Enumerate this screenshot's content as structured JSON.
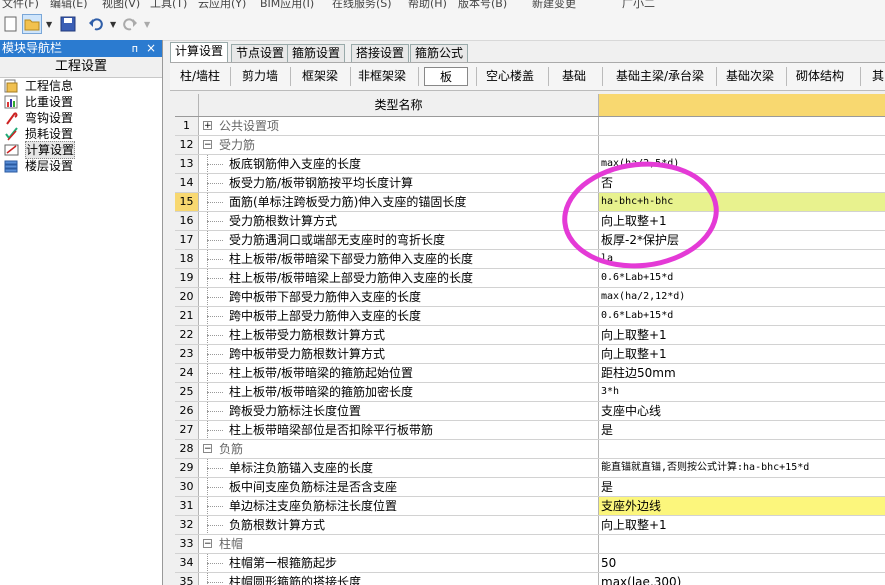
{
  "menu": [
    "文件(F)",
    "编辑(E)",
    "视图(V)",
    "工具(T)",
    "云应用(Y)",
    "BIM应用(I)",
    "在线服务(S)",
    "帮助(H)",
    "版本号(B)",
    "新建变更",
    "广小二"
  ],
  "nav": {
    "title": "模块导航栏",
    "pin_glyph": "ᴨ",
    "close_glyph": "×",
    "section": "工程设置",
    "items": [
      {
        "label": "工程信息",
        "icon": "document-icon"
      },
      {
        "label": "比重设置",
        "icon": "chart-icon"
      },
      {
        "label": "弯钩设置",
        "icon": "hook-icon"
      },
      {
        "label": "损耗设置",
        "icon": "check-icon"
      },
      {
        "label": "计算设置",
        "icon": "calc-icon"
      },
      {
        "label": "楼层设置",
        "icon": "layers-icon"
      }
    ]
  },
  "tabs": [
    "计算设置",
    "节点设置",
    "箍筋设置",
    "搭接设置",
    "箍筋公式"
  ],
  "subtabs": [
    "柱/墙柱",
    "剪力墙",
    "框架梁",
    "非框架梁",
    "板",
    "空心楼盖",
    "基础",
    "基础主梁/承台梁",
    "基础次梁",
    "砌体结构",
    "其"
  ],
  "grid": {
    "header": "类型名称",
    "rows": [
      {
        "n": "1",
        "t": "group",
        "exp": "+",
        "name": "公共设置项",
        "val": ""
      },
      {
        "n": "12",
        "t": "group",
        "exp": "−",
        "name": "受力筋",
        "val": ""
      },
      {
        "n": "13",
        "t": "item",
        "name": "板底钢筋伸入支座的长度",
        "val": "max(ha/2,5*d)"
      },
      {
        "n": "14",
        "t": "item",
        "name": "板受力筋/板带钢筋按平均长度计算",
        "val": "否"
      },
      {
        "n": "15",
        "t": "item",
        "name": "面筋(单标注跨板受力筋)伸入支座的锚固长度",
        "val": "ha-bhc+h-bhc"
      },
      {
        "n": "16",
        "t": "item",
        "name": "受力筋根数计算方式",
        "val": "向上取整+1"
      },
      {
        "n": "17",
        "t": "item",
        "name": "受力筋遇洞口或端部无支座时的弯折长度",
        "val": "板厚-2*保护层"
      },
      {
        "n": "18",
        "t": "item",
        "name": "柱上板带/板带暗梁下部受力筋伸入支座的长度",
        "val": "la"
      },
      {
        "n": "19",
        "t": "item",
        "name": "柱上板带/板带暗梁上部受力筋伸入支座的长度",
        "val": "0.6*Lab+15*d"
      },
      {
        "n": "20",
        "t": "item",
        "name": "跨中板带下部受力筋伸入支座的长度",
        "val": "max(ha/2,12*d)"
      },
      {
        "n": "21",
        "t": "item",
        "name": "跨中板带上部受力筋伸入支座的长度",
        "val": "0.6*Lab+15*d"
      },
      {
        "n": "22",
        "t": "item",
        "name": "柱上板带受力筋根数计算方式",
        "val": "向上取整+1"
      },
      {
        "n": "23",
        "t": "item",
        "name": "跨中板带受力筋根数计算方式",
        "val": "向上取整+1"
      },
      {
        "n": "24",
        "t": "item",
        "name": "柱上板带/板带暗梁的箍筋起始位置",
        "val": "距柱边50mm"
      },
      {
        "n": "25",
        "t": "item",
        "name": "柱上板带/板带暗梁的箍筋加密长度",
        "val": "3*h"
      },
      {
        "n": "26",
        "t": "item",
        "name": "跨板受力筋标注长度位置",
        "val": "支座中心线"
      },
      {
        "n": "27",
        "t": "item",
        "name": "柱上板带暗梁部位是否扣除平行板带筋",
        "val": "是"
      },
      {
        "n": "28",
        "t": "group",
        "exp": "−",
        "name": "负筋",
        "val": ""
      },
      {
        "n": "29",
        "t": "item",
        "name": "单标注负筋锚入支座的长度",
        "val": "能直锚就直锚,否则按公式计算:ha-bhc+15*d"
      },
      {
        "n": "30",
        "t": "item",
        "name": "板中间支座负筋标注是否含支座",
        "val": "是"
      },
      {
        "n": "31",
        "t": "item",
        "name": "单边标注支座负筋标注长度位置",
        "val": "支座外边线"
      },
      {
        "n": "32",
        "t": "item",
        "name": "负筋根数计算方式",
        "val": "向上取整+1"
      },
      {
        "n": "33",
        "t": "group",
        "exp": "−",
        "name": "柱帽",
        "val": ""
      },
      {
        "n": "34",
        "t": "item",
        "name": "柱帽第一根箍筋起步",
        "val": "50"
      },
      {
        "n": "35",
        "t": "item",
        "name": "柱帽圆形箍筋的搭接长度",
        "val": "max(lae,300)"
      }
    ]
  },
  "colors": {
    "title_bar": "#2b7bd0",
    "header_value": "#f8d870",
    "row15": "#e8f28e",
    "row31": "#fcf67c",
    "annotation_circle": "#e43ad6"
  }
}
